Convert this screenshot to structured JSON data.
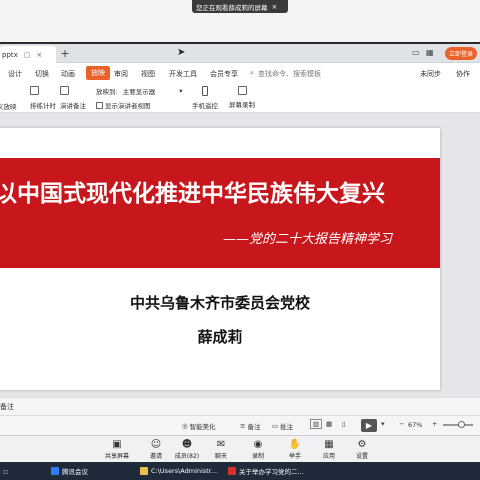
{
  "screen_share_notice": {
    "text": "您正在观看薛成莉的屏幕",
    "close": "×"
  },
  "tabbar": {
    "file_tab": "pptx",
    "new_tab": "+",
    "login_button": "立即登录"
  },
  "menu": {
    "items": [
      "设计",
      "切换",
      "动画",
      "放映",
      "审阅",
      "视图",
      "开发工具",
      "会员专享"
    ],
    "active": "放映",
    "search_placeholder": "查找命令、搜索模板",
    "sync_status": "未同步",
    "collab": "协作"
  },
  "ribbon": {
    "custom_play": "自定义放映",
    "rehearse": "排练计时",
    "speaker_notes": "演讲备注",
    "play_to_label": "放映到:",
    "play_to_value": "主要显示器",
    "show_presenter_view": "显示演讲者视图",
    "phone_remote": "手机遥控",
    "screen_record": "屏幕录制"
  },
  "slide": {
    "title": "以中国式现代化推进中华民族伟大复兴",
    "subtitle": "——党的二十大报告精神学习",
    "organization": "中共乌鲁木齐市委员会党校",
    "author": "薛成莉"
  },
  "notes_bar": {
    "label": "备注"
  },
  "status_bar": {
    "beautify": "智能美化",
    "notes": "备注",
    "comments": "批注",
    "zoom": "67%",
    "minus": "−",
    "plus": "+"
  },
  "meeting_toolbar": {
    "buttons": [
      {
        "label": "共享屏幕",
        "icon": "share-screen-icon",
        "glyph": "▣"
      },
      {
        "label": "邀请",
        "icon": "invite-icon",
        "glyph": "☺"
      },
      {
        "label": "成员(82)",
        "icon": "members-icon",
        "glyph": "☻"
      },
      {
        "label": "聊天",
        "icon": "chat-icon",
        "glyph": "✉"
      },
      {
        "label": "录制",
        "icon": "record-icon",
        "glyph": "◉"
      },
      {
        "label": "举手",
        "icon": "raise-hand-icon",
        "glyph": "✋"
      },
      {
        "label": "应用",
        "icon": "apps-icon",
        "glyph": "▦"
      },
      {
        "label": "设置",
        "icon": "settings-icon",
        "glyph": "⚙"
      }
    ]
  },
  "taskbar": {
    "items": [
      "腾讯会议",
      "C:\\Users\\Administr...",
      "关于举办学习党的二..."
    ]
  },
  "colors": {
    "accent": "#e8622a",
    "slide_red": "#c8161d",
    "taskbar": "#1f2b3a"
  }
}
